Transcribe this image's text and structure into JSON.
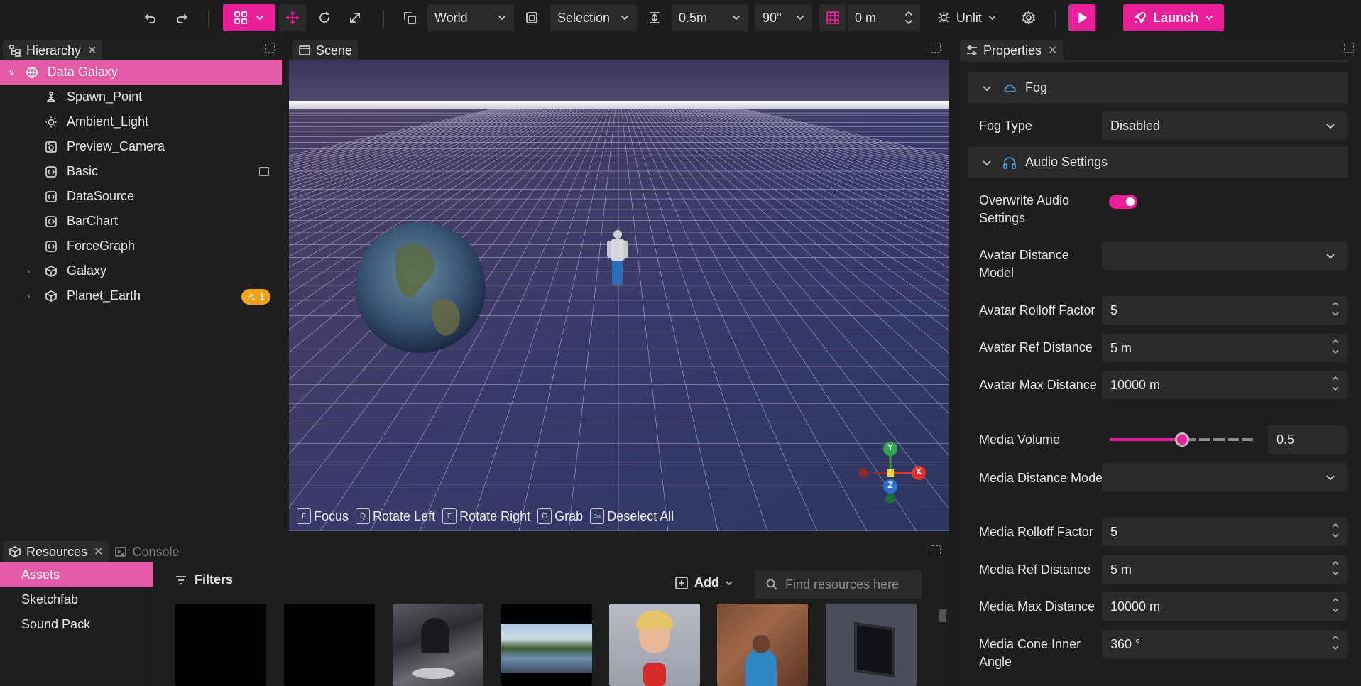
{
  "toolbar": {
    "space_label": "World",
    "pivot_label": "Selection",
    "snap_translate": "0.5m",
    "snap_rotate": "90°",
    "grid_offset": "0 m",
    "lighting_label": "Unlit",
    "launch_label": "Launch",
    "accent_color": "#e91e9a"
  },
  "hierarchy": {
    "tab_label": "Hierarchy",
    "items": [
      {
        "label": "Data Galaxy",
        "icon": "globe-icon"
      },
      {
        "label": "Spawn_Point",
        "icon": "spawn-icon"
      },
      {
        "label": "Ambient_Light",
        "icon": "sun-icon"
      },
      {
        "label": "Preview_Camera",
        "icon": "camera-icon"
      },
      {
        "label": "Basic",
        "icon": "code-icon"
      },
      {
        "label": "DataSource",
        "icon": "code-icon"
      },
      {
        "label": "BarChart",
        "icon": "code-icon"
      },
      {
        "label": "ForceGraph",
        "icon": "code-icon"
      },
      {
        "label": "Galaxy",
        "icon": "cube-icon"
      },
      {
        "label": "Planet_Earth",
        "icon": "cube-icon"
      }
    ],
    "warning_count": "1"
  },
  "scene": {
    "tab_label": "Scene",
    "gizmo": {
      "y": "Y",
      "x": "X",
      "z": "Z"
    },
    "shortcuts": [
      {
        "key": "F",
        "label": "Focus"
      },
      {
        "key": "Q",
        "label": "Rotate Left"
      },
      {
        "key": "E",
        "label": "Rotate Right"
      },
      {
        "key": "G",
        "label": "Grab"
      },
      {
        "key": "Esc",
        "label": "Deselect All"
      }
    ]
  },
  "properties": {
    "tab_label": "Properties",
    "fog_section": "Fog",
    "fog_type_label": "Fog Type",
    "fog_type_value": "Disabled",
    "audio_section": "Audio Settings",
    "overwrite_audio_label": "Overwrite Audio Settings",
    "avatar_distance_model_label": "Avatar Distance Model",
    "avatar_distance_model_value": "",
    "avatar_rolloff_label": "Avatar Rolloff Factor",
    "avatar_rolloff_value": "5",
    "avatar_ref_label": "Avatar Ref Distance",
    "avatar_ref_value": "5 m",
    "avatar_max_label": "Avatar Max Distance",
    "avatar_max_value": "10000 m",
    "media_volume_label": "Media Volume",
    "media_volume_value": "0.5",
    "media_volume_fraction": 0.5,
    "media_distance_model_label": "Media Distance Model",
    "media_distance_model_value": "",
    "media_rolloff_label": "Media Rolloff Factor",
    "media_rolloff_value": "5",
    "media_ref_label": "Media Ref Distance",
    "media_ref_value": "5 m",
    "media_max_label": "Media Max Distance",
    "media_max_value": "10000 m",
    "media_cone_label": "Media Cone Inner Angle",
    "media_cone_value": "360 °"
  },
  "resources": {
    "tab_label": "Resources",
    "console_label": "Console",
    "sidebar": [
      "Assets",
      "Sketchfab",
      "Sound Pack"
    ],
    "filters_label": "Filters",
    "add_label": "Add",
    "search_placeholder": "Find resources here"
  }
}
